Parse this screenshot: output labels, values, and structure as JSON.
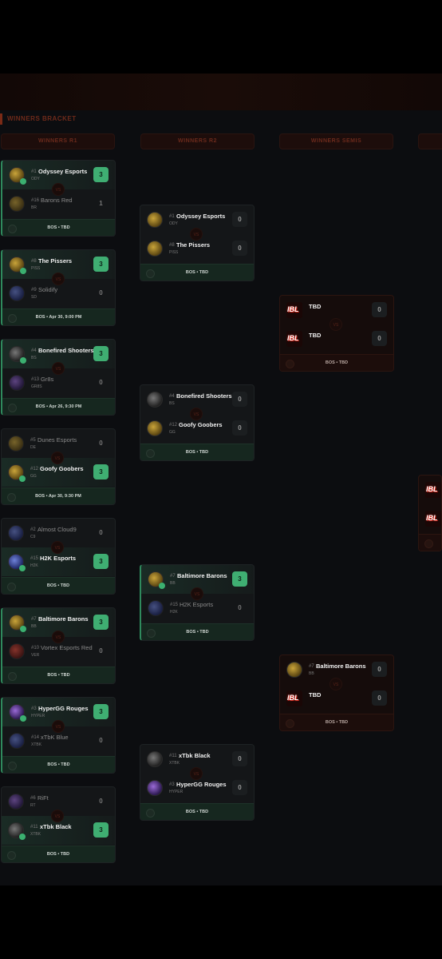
{
  "bracket": {
    "section_title": "WINNERS BRACKET",
    "rounds": [
      "WINNERS R1",
      "WINNERS R2",
      "WINNERS SEMIS"
    ],
    "vs_label": "VS",
    "r1": [
      {
        "t1": {
          "seed": "#1",
          "name": "Odyssey Esports",
          "tag": "ODY",
          "score": "3"
        },
        "t2": {
          "seed": "#16",
          "name": "Barons Red",
          "tag": "BR",
          "score": "1"
        },
        "foot": "BOS • TBD"
      },
      {
        "t1": {
          "seed": "#8",
          "name": "The Pissers",
          "tag": "PISS",
          "score": "3"
        },
        "t2": {
          "seed": "#9",
          "name": "Solidify",
          "tag": "SD",
          "score": "0"
        },
        "foot": "BOS • Apr 30, 9:00 PM"
      },
      {
        "t1": {
          "seed": "#4",
          "name": "Bonefired Shooters",
          "tag": "BS",
          "score": "3"
        },
        "t2": {
          "seed": "#13",
          "name": "Gr8s",
          "tag": "GR8S",
          "score": "0"
        },
        "foot": "BOS • Apr 26, 9:30 PM"
      },
      {
        "t1": {
          "seed": "#5",
          "name": "Dunes Esports",
          "tag": "DE",
          "score": "0"
        },
        "t2": {
          "seed": "#12",
          "name": "Goofy Goobers",
          "tag": "GG",
          "score": "3"
        },
        "foot": "BOS • Apr 30, 9:30 PM"
      },
      {
        "t1": {
          "seed": "#2",
          "name": "Almost Cloud9",
          "tag": "C9",
          "score": "0"
        },
        "t2": {
          "seed": "#15",
          "name": "H2K Esports",
          "tag": "H2K",
          "score": "3"
        },
        "foot": "BOS • TBD"
      },
      {
        "t1": {
          "seed": "#7",
          "name": "Baltimore Barons",
          "tag": "BB",
          "score": "3"
        },
        "t2": {
          "seed": "#10",
          "name": "Vortex Esports Red",
          "tag": "VER",
          "score": "0"
        },
        "foot": "BOS • TBD"
      },
      {
        "t1": {
          "seed": "#3",
          "name": "HyperGG Rouges",
          "tag": "HYPER",
          "score": "3"
        },
        "t2": {
          "seed": "#14",
          "name": "xTbK Blue",
          "tag": "XTBK",
          "score": "0"
        },
        "foot": "BOS • TBD"
      },
      {
        "t1": {
          "seed": "#6",
          "name": "RiFt",
          "tag": "RT",
          "score": "0"
        },
        "t2": {
          "seed": "#11",
          "name": "xTbk Black",
          "tag": "XTBK",
          "score": "3"
        },
        "foot": "BOS • TBD"
      }
    ],
    "r2": [
      {
        "t1": {
          "seed": "#1",
          "name": "Odyssey Esports",
          "tag": "ODY",
          "score": "0"
        },
        "t2": {
          "seed": "#8",
          "name": "The Pissers",
          "tag": "PISS",
          "score": "0"
        },
        "foot": "BOS • TBD"
      },
      {
        "t1": {
          "seed": "#4",
          "name": "Bonefired Shooters",
          "tag": "BS",
          "score": "0"
        },
        "t2": {
          "seed": "#12",
          "name": "Goofy Goobers",
          "tag": "GG",
          "score": "0"
        },
        "foot": "BOS • TBD"
      },
      {
        "t1": {
          "seed": "#7",
          "name": "Baltimore Barons",
          "tag": "BB",
          "score": "3"
        },
        "t2": {
          "seed": "#15",
          "name": "H2K Esports",
          "tag": "H2K",
          "score": "0"
        },
        "foot": "BOS • TBD"
      },
      {
        "t1": {
          "seed": "#11",
          "name": "xTbk Black",
          "tag": "XTBK",
          "score": "0"
        },
        "t2": {
          "seed": "#3",
          "name": "HyperGG Rouges",
          "tag": "HYPER",
          "score": "0"
        },
        "foot": "BOS • TBD"
      }
    ],
    "semis": [
      {
        "t1": {
          "name": "TBD",
          "score": "0"
        },
        "t2": {
          "name": "TBD",
          "score": "0"
        },
        "foot": "BOS • TBD"
      },
      {
        "t1": {
          "seed": "#7",
          "name": "Baltimore Barons",
          "tag": "BB",
          "score": "0"
        },
        "t2": {
          "name": "TBD",
          "score": "0"
        },
        "foot": "BOS • TBD"
      }
    ]
  },
  "colors": {
    "accent_green": "#3fae72",
    "accent_red": "#7a2a16",
    "background": "#0c0d10"
  }
}
